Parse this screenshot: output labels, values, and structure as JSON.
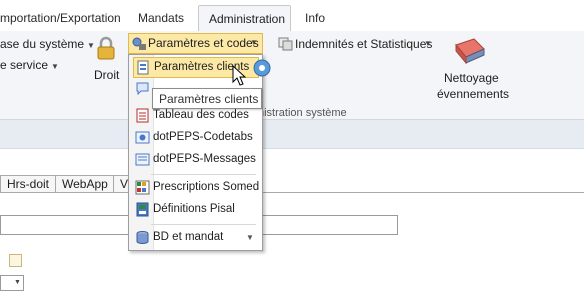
{
  "tabs": {
    "import_export": "mportation/Exportation",
    "mandats": "Mandats",
    "administration": "Administration",
    "info": "Info"
  },
  "ribbon": {
    "base_systeme": "ase du système",
    "service": "e service",
    "droit": "Droit",
    "parametres_codes": "Paramètres et codes",
    "indemnites": "Indemnités et Statistiques",
    "nettoyage_line1": "Nettoyage",
    "nettoyage_line2": "évennements",
    "group_label": "nistration système"
  },
  "menu": {
    "items": [
      {
        "label": "Paramètres clients",
        "icon": "client-settings-icon"
      },
      {
        "label": "Tableau des codes",
        "icon": "codes-table-icon"
      },
      {
        "label": "dotPEPS-Codetabs",
        "icon": "codetabs-icon"
      },
      {
        "label": "dotPEPS-Messages",
        "icon": "messages-icon"
      },
      {
        "label": "Prescriptions Somed",
        "icon": "prescriptions-icon"
      },
      {
        "label": "Définitions Pisal",
        "icon": "definitions-icon"
      },
      {
        "label": "BD et mandat",
        "icon": "database-icon"
      }
    ],
    "tooltip": "Paramètres clients"
  },
  "doc_tabs": [
    "Hrs-doit",
    "WebApp",
    "V"
  ],
  "colors": {
    "accent_highlight": "#fde9a6",
    "ribbon_bg": "#f3f5f8",
    "subbar_bg": "#e7ebf2"
  }
}
